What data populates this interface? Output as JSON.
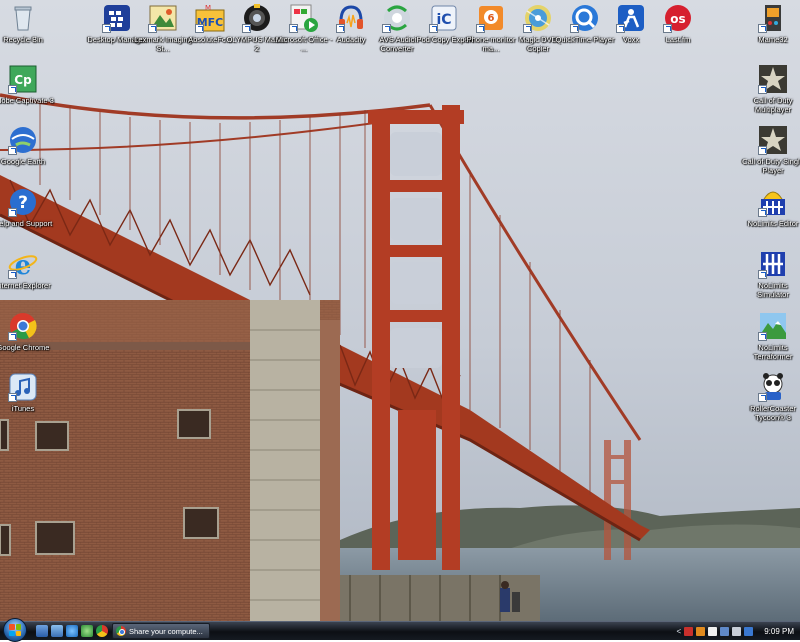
{
  "desktop": {
    "top_icons": [
      {
        "label": "Recycle Bin",
        "icon": "recycle-bin-icon"
      },
      {
        "label": "Desktop Manager",
        "icon": "blackberry-desktop-icon"
      },
      {
        "label": "Lexmark Imaging St...",
        "icon": "lexmark-imaging-icon"
      },
      {
        "label": "AbsoluteFc...",
        "icon": "mfc-app-icon"
      },
      {
        "label": "OLYMPUS Master 2",
        "icon": "olympus-camera-icon"
      },
      {
        "label": "Microsoft Office - ...",
        "icon": "office-media-icon"
      },
      {
        "label": "Audacity",
        "icon": "audacity-headphones-icon"
      },
      {
        "label": "AVS Audio Converter",
        "icon": "avs-audio-converter-icon"
      },
      {
        "label": "iPod Copy Expert",
        "icon": "ipod-copy-expert-icon"
      },
      {
        "label": "Phone monitor ma...",
        "icon": "phone-monitor-icon"
      },
      {
        "label": "Magic DVD Copier",
        "icon": "magic-dvd-icon"
      },
      {
        "label": "QuickTime Player",
        "icon": "quicktime-icon"
      },
      {
        "label": "Voxx",
        "icon": "voxx-icon"
      },
      {
        "label": "Last.fm",
        "icon": "lastfm-icon"
      },
      {
        "label": "Mame32",
        "icon": "mame-icon"
      }
    ],
    "left_icons": [
      {
        "label": "Adobe Captivate 3",
        "icon": "adobe-captivate-icon"
      },
      {
        "label": "Google Earth",
        "icon": "google-earth-icon"
      },
      {
        "label": "Help and Support",
        "icon": "help-support-icon"
      },
      {
        "label": "Internet Explorer",
        "icon": "internet-explorer-icon"
      },
      {
        "label": "Google Chrome",
        "icon": "google-chrome-icon"
      },
      {
        "label": "iTunes",
        "icon": "itunes-icon"
      }
    ],
    "right_icons": [
      {
        "label": "Call of Duty Multiplayer",
        "icon": "call-of-duty-icon"
      },
      {
        "label": "Call of Duty Single Player",
        "icon": "call-of-duty-icon"
      },
      {
        "label": "NoLimits Editor",
        "icon": "nolimits-editor-icon"
      },
      {
        "label": "NoLimits Simulator",
        "icon": "nolimits-simulator-icon"
      },
      {
        "label": "NoLimits Terraformer",
        "icon": "nolimits-terraformer-icon"
      },
      {
        "label": "RollerCoaster Tycoon® 3",
        "icon": "rollercoaster-tycoon-icon"
      }
    ]
  },
  "taskbar": {
    "start_icon": "windows-start-orb-icon",
    "quick_launch_more": "»",
    "active_task_label": "Share your compute...",
    "active_task_icon": "google-chrome-icon",
    "tray_chevron": "<",
    "clock": "9:09 PM"
  },
  "colors": {
    "taskbar": "#0c0f14",
    "sky": "#c9cfd9",
    "bridge": "#b03a22",
    "water": "#7f8f9c"
  }
}
